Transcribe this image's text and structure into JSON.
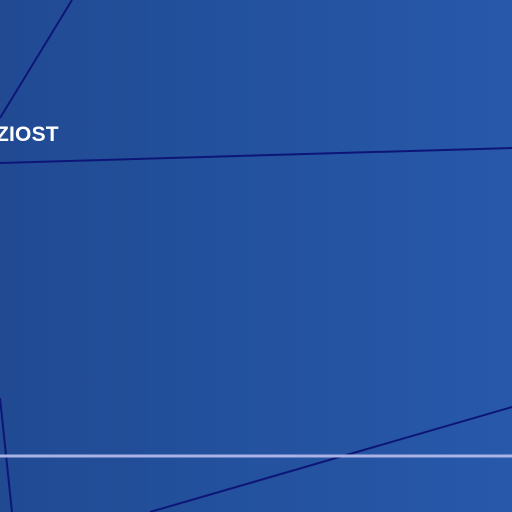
{
  "background": {
    "gradient_left_color": "#214a93",
    "gradient_right_color": "#2758aa"
  },
  "decoration": {
    "thin_line_color": "#0d1677",
    "horizontal_rule_color": "#aab3e6"
  },
  "heading": {
    "visible_text": "ZIOST",
    "text_color": "#ffffff"
  }
}
